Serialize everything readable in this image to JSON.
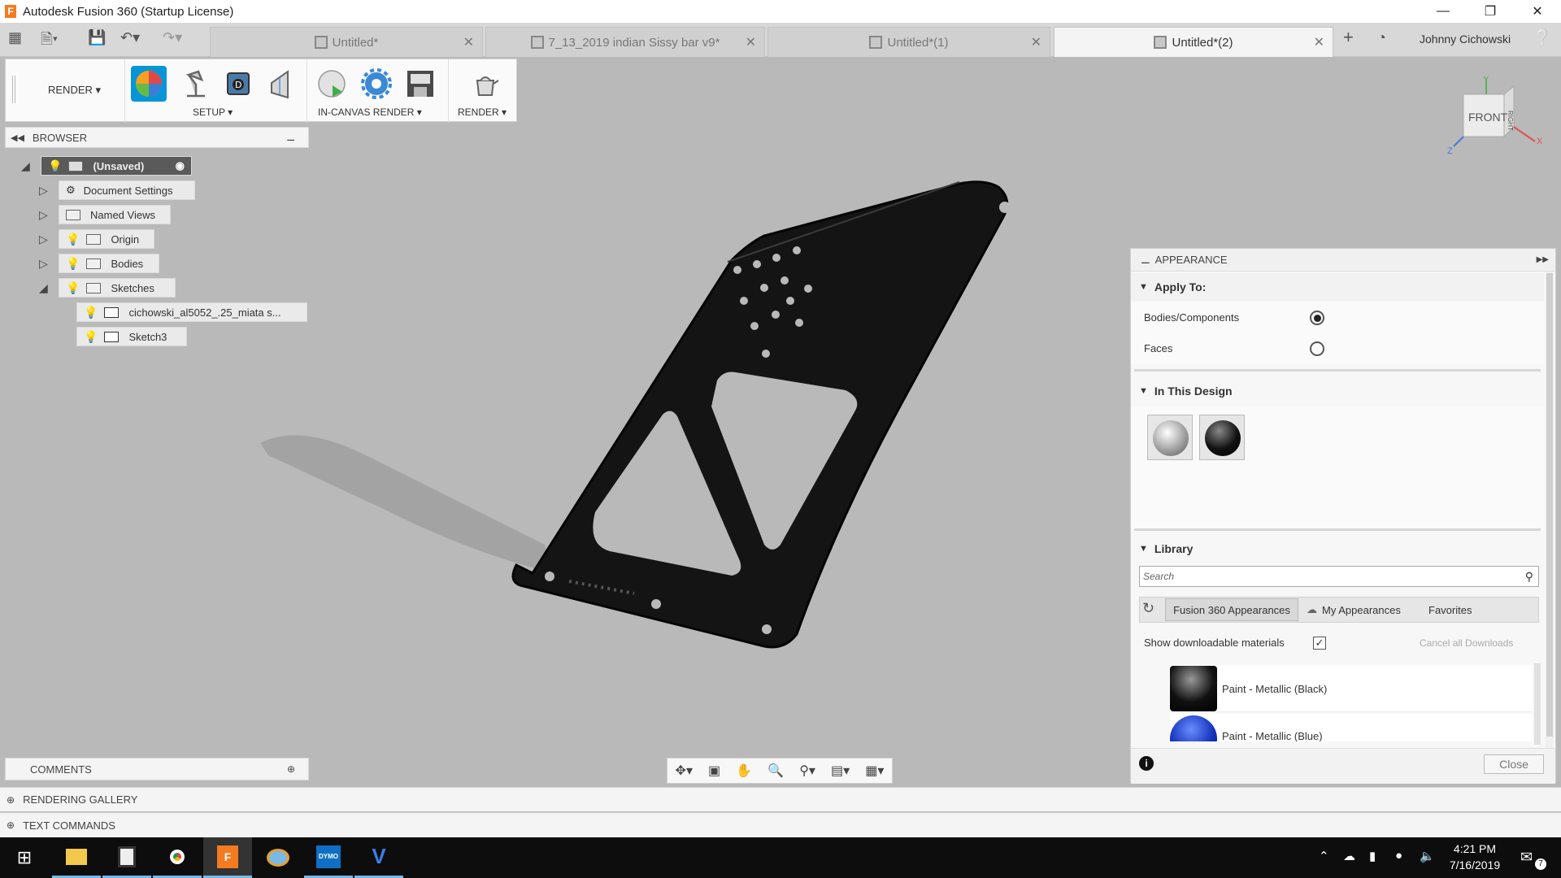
{
  "window": {
    "title": "Autodesk Fusion 360 (Startup License)",
    "app_letter": "F"
  },
  "tabs": [
    {
      "label": "Untitled*"
    },
    {
      "label": "7_13_2019 indian Sissy bar v9*"
    },
    {
      "label": "Untitled*(1)"
    },
    {
      "label": "Untitled*(2)"
    }
  ],
  "user": {
    "name": "Johnny Cichowski"
  },
  "toolbar": {
    "workspace": "RENDER",
    "groups": {
      "setup": "SETUP",
      "in_canvas": "IN-CANVAS RENDER",
      "render": "RENDER"
    }
  },
  "browser": {
    "title": "BROWSER",
    "root": "(Unsaved)",
    "items": [
      {
        "label": "Document Settings"
      },
      {
        "label": "Named Views"
      },
      {
        "label": "Origin"
      },
      {
        "label": "Bodies"
      },
      {
        "label": "Sketches"
      },
      {
        "label": "cichowski_al5052_.25_miata s..."
      },
      {
        "label": "Sketch3"
      }
    ]
  },
  "viewcube": {
    "face": "FRONT",
    "side": "RIGHT",
    "axis_y": "Y",
    "axis_x": "X",
    "axis_z": "Z"
  },
  "comments": {
    "title": "COMMENTS"
  },
  "bottom": {
    "gallery": "RENDERING GALLERY",
    "commands": "TEXT COMMANDS"
  },
  "appearance": {
    "title": "APPEARANCE",
    "apply_to": "Apply To:",
    "opt_bodies": "Bodies/Components",
    "opt_faces": "Faces",
    "in_design": "In This Design",
    "library": "Library",
    "search_placeholder": "Search",
    "lib_tabs": [
      "Fusion 360 Appearances",
      "My Appearances",
      "Favorites"
    ],
    "show_downloadable": "Show downloadable materials",
    "cancel_downloads": "Cancel all Downloads",
    "materials": [
      "Paint - Metallic (Black)",
      "Paint - Metallic (Blue)"
    ],
    "close": "Close"
  },
  "taskbar": {
    "time": "4:21 PM",
    "date": "7/16/2019",
    "notifications": "7",
    "dymo": "DYMO"
  },
  "colors": {
    "accent": "#0696d7",
    "canvas": "#b9b9b9",
    "part": "#141414"
  }
}
